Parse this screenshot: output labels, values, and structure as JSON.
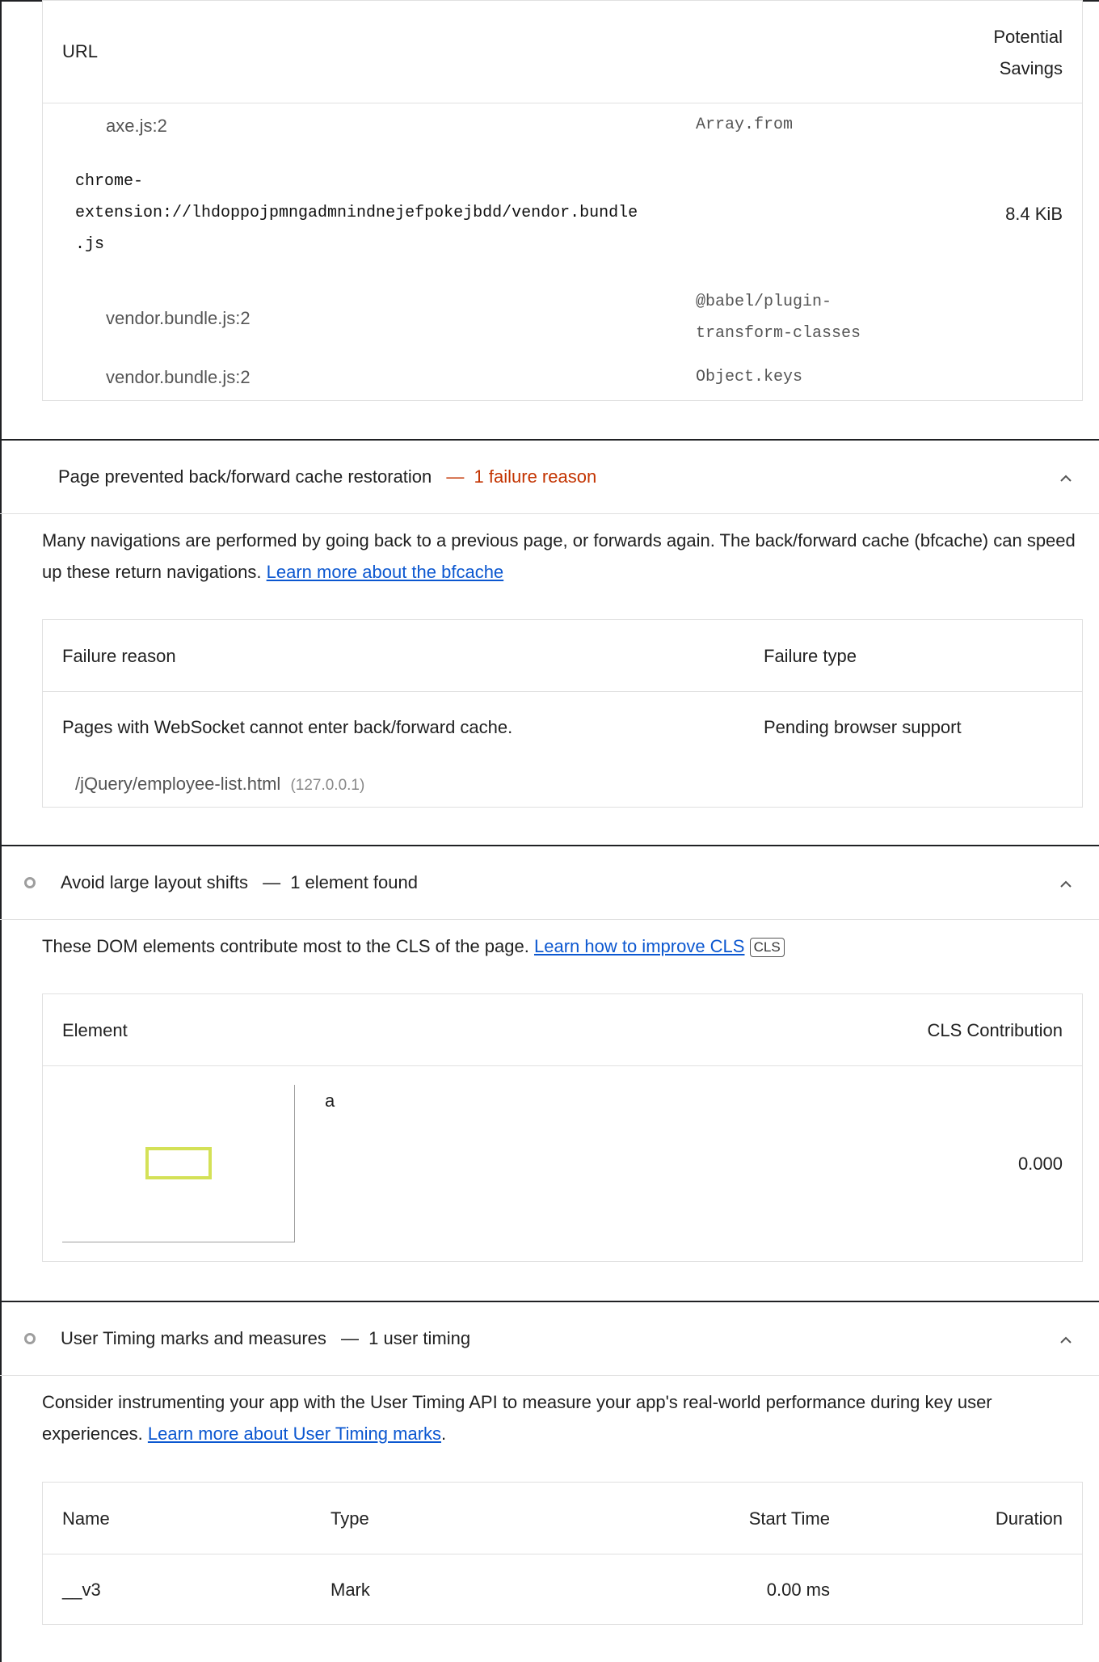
{
  "unused_js_table": {
    "col_url": "URL",
    "col_savings_line1": "Potential",
    "col_savings_line2": "Savings",
    "rows": [
      {
        "source": "axe.js:2",
        "code": "Array.from"
      },
      {
        "url_line1": "chrome-",
        "url_line2": "extension://lhdoppojpmngadmnindnejefpokejbdd/vendor.bundle",
        "url_line3": ".js",
        "savings": "8.4 KiB"
      },
      {
        "source": "vendor.bundle.js:2",
        "code_line1": "@babel/plugin-",
        "code_line2": "transform-classes"
      },
      {
        "source": "vendor.bundle.js:2",
        "code": "Object.keys"
      }
    ]
  },
  "bfcache_audit": {
    "title": "Page prevented back/forward cache restoration",
    "separator": "—",
    "display_value": "1 failure reason",
    "description": "Many navigations are performed by going back to a previous page, or forwards again. The back/forward cache (bfcache) can speed up these return navigations.",
    "link": "Learn more about the bfcache",
    "col_reason": "Failure reason",
    "col_type": "Failure type",
    "reason": "Pages with WebSocket cannot enter back/forward cache.",
    "type": "Pending browser support",
    "frame_url": "/jQuery/employee-list.html",
    "frame_host": "(127.0.0.1)"
  },
  "layout_shift_audit": {
    "title": "Avoid large layout shifts",
    "separator": "—",
    "display_value": "1 element found",
    "description": "These DOM elements contribute most to the CLS of the page.",
    "link": "Learn how to improve CLS",
    "badge": "CLS",
    "col_element": "Element",
    "col_contribution": "CLS Contribution",
    "element_label": "a",
    "contribution": "0.000"
  },
  "user_timing_audit": {
    "title": "User Timing marks and measures",
    "separator": "—",
    "display_value": "1 user timing",
    "description": "Consider instrumenting your app with the User Timing API to measure your app's real-world performance during key user experiences.",
    "link": "Learn more about User Timing marks",
    "link_suffix": ".",
    "col_name": "Name",
    "col_type": "Type",
    "col_start": "Start Time",
    "col_duration": "Duration",
    "row_name": "__v3",
    "row_type": "Mark",
    "row_start": "0.00 ms"
  },
  "colors": {
    "failure": "#c33300",
    "link": "#0b57d0",
    "highlight": "#d4e157"
  }
}
